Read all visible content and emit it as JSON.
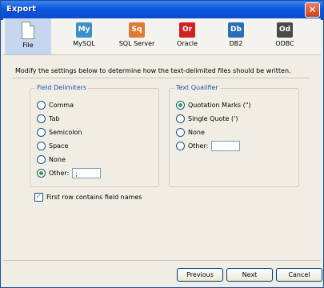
{
  "window": {
    "title": "Export",
    "close_glyph": "✕"
  },
  "toolbar": [
    {
      "label": "File",
      "icon": "file-icon",
      "glyph": "",
      "color": "",
      "selected": true
    },
    {
      "label": "MySQL",
      "icon": "mysql-icon",
      "glyph": "My",
      "color": "#3c8fc9"
    },
    {
      "label": "SQL Server",
      "icon": "sqlserver-icon",
      "glyph": "Sq",
      "color": "#e07a36"
    },
    {
      "label": "Oracle",
      "icon": "oracle-icon",
      "glyph": "Or",
      "color": "#d22121"
    },
    {
      "label": "DB2",
      "icon": "db2-icon",
      "glyph": "Db",
      "color": "#2a6fb7"
    },
    {
      "label": "ODBC",
      "icon": "odbc-icon",
      "glyph": "Od",
      "color": "#4a4a4a"
    }
  ],
  "intro": "Modify the settings below to determine how the text-delimited files should be written.",
  "field_delimiters": {
    "title": "Field Delimiters",
    "options": [
      {
        "label": "Comma",
        "checked": false
      },
      {
        "label": "Tab",
        "checked": false
      },
      {
        "label": "Semicolon",
        "checked": false
      },
      {
        "label": "Space",
        "checked": false
      },
      {
        "label": "None",
        "checked": false
      },
      {
        "label": "Other:",
        "checked": true
      }
    ],
    "other_value": ";"
  },
  "text_qualifier": {
    "title": "Text Qualifier",
    "options": [
      {
        "label": "Quotation Marks (\")",
        "checked": true
      },
      {
        "label": "Single Quote (')",
        "checked": false
      },
      {
        "label": "None",
        "checked": false
      },
      {
        "label": "Other:",
        "checked": false
      }
    ],
    "other_value": ""
  },
  "first_row": {
    "label": "First row contains field names",
    "checked": true,
    "check_glyph": "✓"
  },
  "buttons": {
    "previous": "Previous",
    "next": "Next",
    "cancel": "Cancel"
  }
}
